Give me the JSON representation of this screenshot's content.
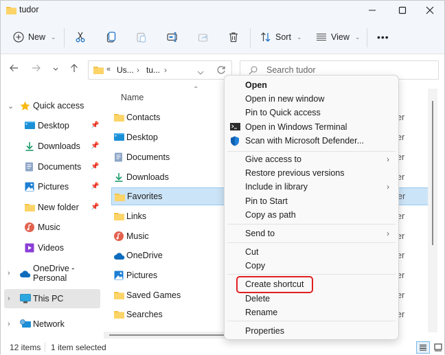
{
  "window": {
    "title": "tudor",
    "controls": {
      "minimize": "minimize-icon",
      "maximize": "maximize-icon",
      "close": "close-icon"
    }
  },
  "toolbar": {
    "new_label": "New",
    "sort_label": "Sort",
    "view_label": "View",
    "more_label": "•••",
    "icons": [
      "new-icon",
      "cut-icon",
      "copy-icon",
      "paste-icon",
      "rename-icon",
      "share-icon",
      "delete-icon",
      "sort-icon",
      "view-icon",
      "more-icon"
    ]
  },
  "navigation": {
    "breadcrumb": [
      "«",
      "Us...",
      "›",
      "tu...",
      "›"
    ],
    "search_placeholder": "Search tudor"
  },
  "sidebar": {
    "items": [
      {
        "label": "Quick access",
        "icon": "star-icon",
        "expanded": true
      },
      {
        "label": "Desktop",
        "icon": "desktop-icon",
        "pinned": true
      },
      {
        "label": "Downloads",
        "icon": "downloads-icon",
        "pinned": true
      },
      {
        "label": "Documents",
        "icon": "documents-icon",
        "pinned": true
      },
      {
        "label": "Pictures",
        "icon": "pictures-icon",
        "pinned": true
      },
      {
        "label": "New folder",
        "icon": "folder-icon",
        "pinned": true
      },
      {
        "label": "Music",
        "icon": "music-icon"
      },
      {
        "label": "Videos",
        "icon": "videos-icon"
      },
      {
        "label": "OneDrive - Personal",
        "icon": "onedrive-icon"
      },
      {
        "label": "This PC",
        "icon": "this-pc-icon",
        "selected": true
      },
      {
        "label": "Network",
        "icon": "network-icon"
      }
    ]
  },
  "filelist": {
    "column_name": "Name",
    "type_suffix": "er",
    "rows": [
      {
        "name": "Contacts",
        "icon": "folder-icon"
      },
      {
        "name": "Desktop",
        "icon": "desktop-icon"
      },
      {
        "name": "Documents",
        "icon": "documents-icon"
      },
      {
        "name": "Downloads",
        "icon": "downloads-icon"
      },
      {
        "name": "Favorites",
        "icon": "folder-icon",
        "selected": true
      },
      {
        "name": "Links",
        "icon": "folder-icon"
      },
      {
        "name": "Music",
        "icon": "music-icon"
      },
      {
        "name": "OneDrive",
        "icon": "onedrive-icon"
      },
      {
        "name": "Pictures",
        "icon": "pictures-icon"
      },
      {
        "name": "Saved Games",
        "icon": "folder-icon"
      },
      {
        "name": "Searches",
        "icon": "folder-icon"
      }
    ]
  },
  "context_menu": {
    "items": [
      {
        "label": "Open",
        "bold": true
      },
      {
        "label": "Open in new window"
      },
      {
        "label": "Pin to Quick access"
      },
      {
        "label": "Open in Windows Terminal",
        "icon": "terminal-icon"
      },
      {
        "label": "Scan with Microsoft Defender...",
        "icon": "defender-icon"
      },
      {
        "label": "Give access to",
        "submenu": true
      },
      {
        "label": "Restore previous versions"
      },
      {
        "label": "Include in library",
        "submenu": true
      },
      {
        "label": "Pin to Start"
      },
      {
        "label": "Copy as path"
      },
      {
        "label": "Send to",
        "submenu": true
      },
      {
        "label": "Cut"
      },
      {
        "label": "Copy"
      },
      {
        "label": "Create shortcut",
        "highlighted": true
      },
      {
        "label": "Delete"
      },
      {
        "label": "Rename"
      },
      {
        "label": "Properties"
      }
    ],
    "submenu_glyph": "›"
  },
  "status": {
    "item_count": "12 items",
    "selection": "1 item selected"
  },
  "colors": {
    "accent": "#0067c0",
    "selection_bg": "#cce4f7",
    "highlight_box": "#e02020"
  }
}
